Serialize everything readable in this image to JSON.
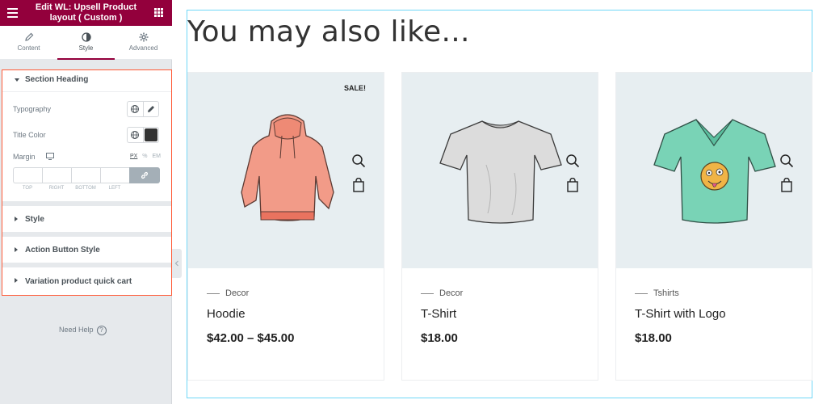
{
  "editor": {
    "title": "Edit WL: Upsell Product layout ( Custom )",
    "tabs": [
      {
        "label": "Content",
        "icon": "pencil-icon",
        "active": false
      },
      {
        "label": "Style",
        "icon": "contrast-icon",
        "active": true
      },
      {
        "label": "Advanced",
        "icon": "gear-icon",
        "active": false
      }
    ],
    "sections": [
      {
        "label": "Section Heading",
        "expanded": true
      },
      {
        "label": "Style",
        "expanded": false
      },
      {
        "label": "Action Button Style",
        "expanded": false
      },
      {
        "label": "Variation product quick cart",
        "expanded": false
      }
    ],
    "controls": {
      "typography_label": "Typography",
      "title_color_label": "Title Color",
      "title_color": "#333333",
      "margin_label": "Margin",
      "units": [
        "PX",
        "%",
        "EM"
      ],
      "active_unit": "PX",
      "dimension_labels": [
        "TOP",
        "RIGHT",
        "BOTTOM",
        "LEFT"
      ]
    },
    "need_help": "Need Help",
    "colors": {
      "brand": "#93003c",
      "highlight_border": "#ff5a36",
      "canvas_border": "#71d7f7"
    }
  },
  "preview": {
    "heading": "You may also like...",
    "products": [
      {
        "category": "Decor",
        "name": "Hoodie",
        "price": "$42.00 – $45.00",
        "badge": "SALE!",
        "image": "hoodie"
      },
      {
        "category": "Decor",
        "name": "T-Shirt",
        "price": "$18.00",
        "badge": "",
        "image": "tshirt-gray"
      },
      {
        "category": "Tshirts",
        "name": "T-Shirt with Logo",
        "price": "$18.00",
        "badge": "",
        "image": "tshirt-logo"
      }
    ]
  }
}
